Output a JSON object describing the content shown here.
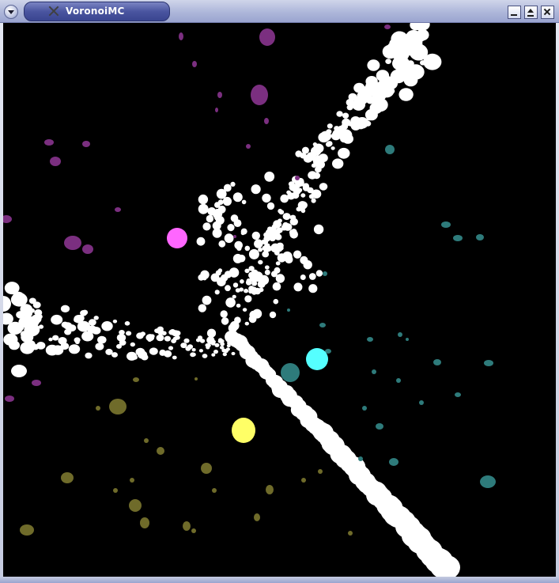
{
  "window": {
    "title": "VoronoiMC",
    "icon": "app-icon-crossed-tools",
    "buttons": [
      "minimize",
      "maximize",
      "close"
    ]
  },
  "scene": {
    "background": "#000000",
    "colors": {
      "white": "#ffffff",
      "purple": "#7b2f80",
      "magenta": "#ff66ff",
      "teal": "#2e7b7b",
      "cyan": "#55ffff",
      "olive": "#6f6b2a",
      "yellow": "#ffff66"
    }
  }
}
